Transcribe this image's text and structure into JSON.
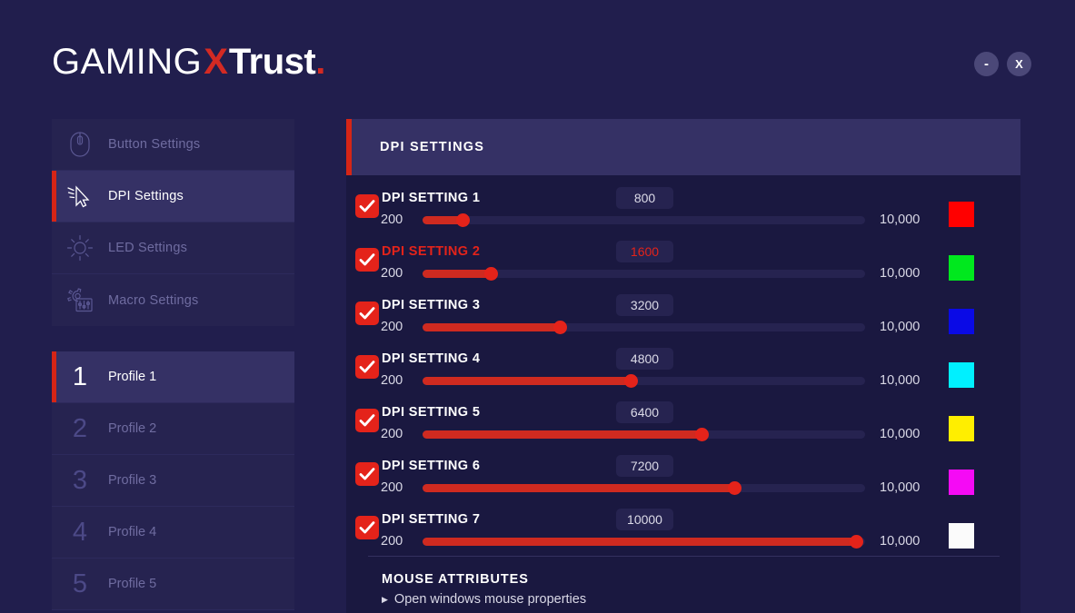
{
  "app": {
    "logo": {
      "gaming": "GAMING",
      "x": "X",
      "trust": "Trust",
      "dot": "."
    },
    "window_controls": {
      "minimize_label": "-",
      "close_label": "X",
      "button_color": "#4b4878"
    }
  },
  "sidebar": {
    "settings_items": [
      {
        "label": "Button Settings",
        "icon": "mouse-icon",
        "active": false
      },
      {
        "label": "DPI Settings",
        "icon": "cursor-icon",
        "active": true
      },
      {
        "label": "LED Settings",
        "icon": "sun-icon",
        "active": false
      },
      {
        "label": "Macro Settings",
        "icon": "macro-gear-icon",
        "active": false
      }
    ],
    "profile_items": [
      {
        "number": "1",
        "label": "Profile 1",
        "active": true
      },
      {
        "number": "2",
        "label": "Profile 2",
        "active": false
      },
      {
        "number": "3",
        "label": "Profile 3",
        "active": false
      },
      {
        "number": "4",
        "label": "Profile 4",
        "active": false
      },
      {
        "number": "5",
        "label": "Profile 5",
        "active": false
      }
    ]
  },
  "main": {
    "panel_title": "DPI SETTINGS",
    "accent_color": "#d62516",
    "slider_min_label": "200",
    "slider_max_label": "10,000",
    "dpi_rows": [
      {
        "label": "DPI SETTING 1",
        "value": "800",
        "min": "200",
        "max": "10,000",
        "checked": true,
        "percent": 9,
        "color": "#ff0000",
        "highlight": false
      },
      {
        "label": "DPI SETTING 2",
        "value": "1600",
        "min": "200",
        "max": "10,000",
        "checked": true,
        "percent": 15.5,
        "color": "#00e81e",
        "highlight": true
      },
      {
        "label": "DPI SETTING 3",
        "value": "3200",
        "min": "200",
        "max": "10,000",
        "checked": true,
        "percent": 31,
        "color": "#0a0ae6",
        "highlight": false
      },
      {
        "label": "DPI SETTING 4",
        "value": "4800",
        "min": "200",
        "max": "10,000",
        "checked": true,
        "percent": 47,
        "color": "#00f0ff",
        "highlight": false
      },
      {
        "label": "DPI SETTING 5",
        "value": "6400",
        "min": "200",
        "max": "10,000",
        "checked": true,
        "percent": 63,
        "color": "#ffee00",
        "highlight": false
      },
      {
        "label": "DPI SETTING 6",
        "value": "7200",
        "min": "200",
        "max": "10,000",
        "checked": true,
        "percent": 70.5,
        "color": "#f50af5",
        "highlight": false
      },
      {
        "label": "DPI SETTING 7",
        "value": "10000",
        "min": "200",
        "max": "10,000",
        "checked": true,
        "percent": 98,
        "color": "#fbfbfb",
        "highlight": false
      }
    ],
    "mouse_attributes": {
      "title": "MOUSE ATTRIBUTES",
      "arrow": "▶",
      "link_label": "Open windows mouse properties"
    }
  }
}
